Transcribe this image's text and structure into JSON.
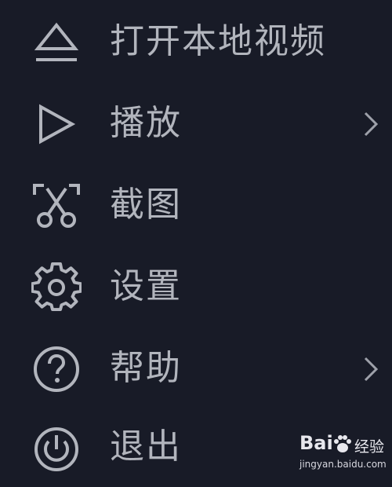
{
  "menu": {
    "items": [
      {
        "label": "打开本地视频",
        "icon": "eject-icon",
        "has_submenu": false
      },
      {
        "label": "播放",
        "icon": "play-icon",
        "has_submenu": true
      },
      {
        "label": "截图",
        "icon": "screenshot-scissors-icon",
        "has_submenu": false
      },
      {
        "label": "设置",
        "icon": "gear-icon",
        "has_submenu": false
      },
      {
        "label": "帮助",
        "icon": "help-icon",
        "has_submenu": true
      },
      {
        "label": "退出",
        "icon": "power-icon",
        "has_submenu": false
      }
    ]
  },
  "watermark": {
    "logo": "Bai",
    "brand": "经验",
    "url": "jingyan.baidu.com"
  },
  "colors": {
    "background": "#181b27",
    "text": "#b2b5bd",
    "icon": "#b2b5bd"
  }
}
